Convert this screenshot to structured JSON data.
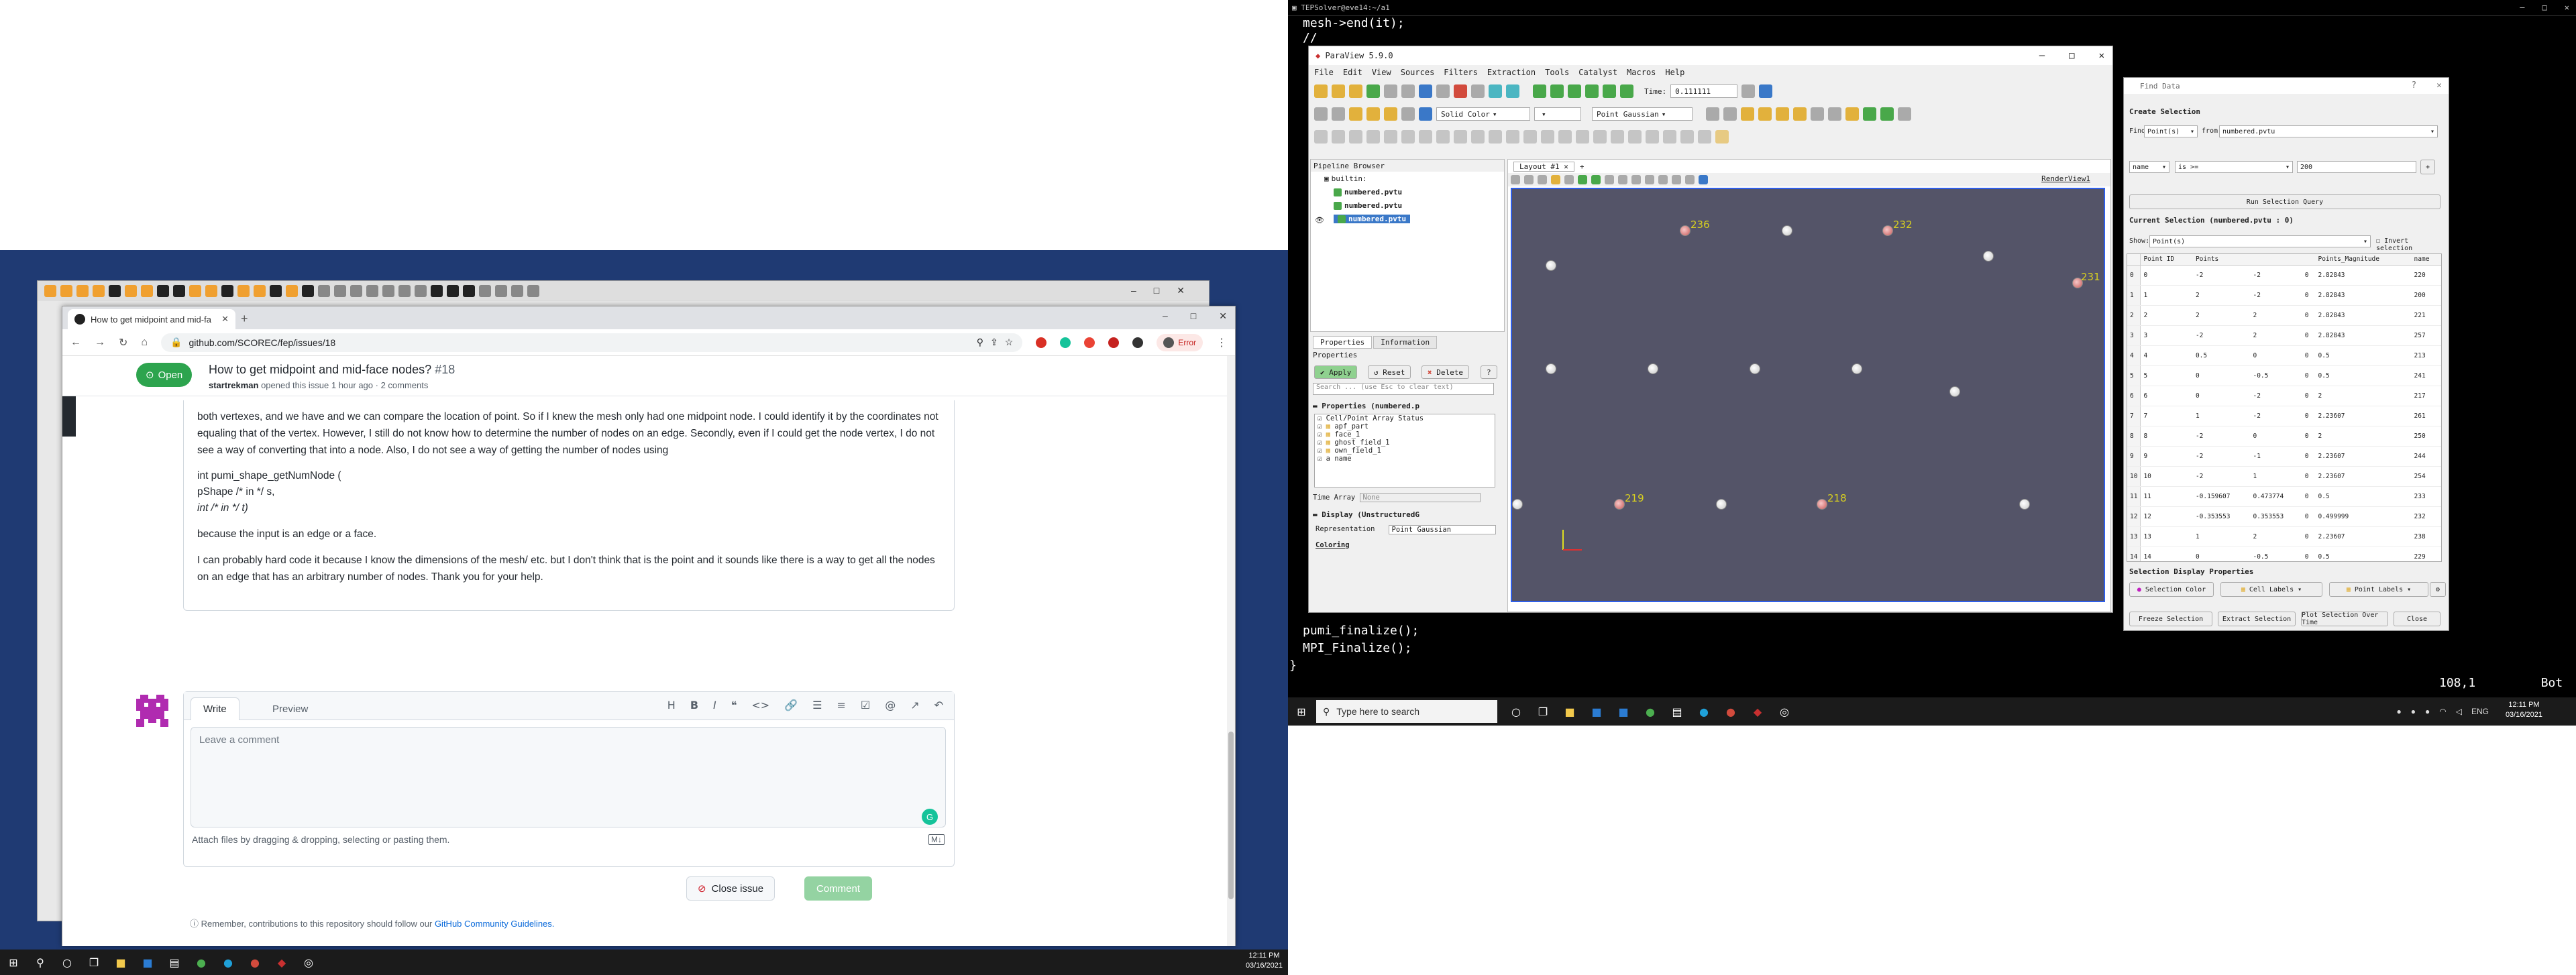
{
  "left_monitor": {
    "browser": {
      "tab_title": "How to get midpoint and mid-fa",
      "url": "github.com/SCOREC/fep/issues/18",
      "profile_label": "Error",
      "issue": {
        "state": "Open",
        "title": "How to get midpoint and mid-face nodes?",
        "number": "#18",
        "author": "startrekman",
        "opened_text": "opened this issue 1 hour ago · 2 comments",
        "body": [
          "both vertexes, and we have and we can compare the location of point. So if I knew the mesh only had one midpoint node. I could identify it by the coordinates not equaling that of the vertex. However, I still do not know how to determine the number of nodes on an edge. Secondly, even if I could get the node vertex, I do not see a way of converting that into a node. Also, I do not see a way of getting the number of nodes using",
          "because the input is an edge or a face.",
          "I can probably hard code it because I know the dimensions of the mesh/ etc. but I don't think that is the point and it sounds like there is a way to get all the nodes on an edge that has an arbitrary number of nodes. Thank you for your help."
        ],
        "code": [
          "int pumi_shape_getNumNode (",
          "pShape /* in */ s,",
          "int /* in */ t)"
        ]
      },
      "editor": {
        "tab_write": "Write",
        "tab_preview": "Preview",
        "placeholder": "Leave a comment",
        "attach_text": "Attach files by dragging & dropping, selecting or pasting them.",
        "close_issue": "Close issue",
        "comment": "Comment"
      },
      "note_prefix": "Remember, contributions to this repository should follow our",
      "note_link": "GitHub Community Guidelines."
    },
    "clock": {
      "time": "12:11 PM",
      "date": "03/16/2021"
    }
  },
  "right_monitor": {
    "terminal": {
      "title": "TEPSolver@eve14:~/a1",
      "lines_top": [
        "mesh->end(it);",
        "//"
      ],
      "lines_bottom": [
        "pumi_finalize();",
        "MPI_Finalize();",
        "}"
      ],
      "vim_status": "108,1         Bot"
    },
    "taskbar": {
      "search_placeholder": "Type here to search",
      "lang": "ENG",
      "time": "12:11 PM",
      "date": "03/16/2021"
    },
    "paraview": {
      "title": "ParaView 5.9.0",
      "menu": [
        "File",
        "Edit",
        "View",
        "Sources",
        "Filters",
        "Extraction",
        "Tools",
        "Catalyst",
        "Macros",
        "Help"
      ],
      "time_label": "Time:",
      "time_value": "0.111111",
      "color_mode": "Solid Color",
      "representation_select": "Point Gaussian",
      "pipeline_title": "Pipeline Browser",
      "pipeline_items": [
        "builtin:",
        "numbered.pvtu",
        "numbered.pvtu",
        "numbered.pvtu"
      ],
      "tab_properties": "Properties",
      "tab_information": "Information",
      "props_title": "Properties",
      "btn_apply": "Apply",
      "btn_reset": "Reset",
      "btn_delete": "Delete",
      "search_props": "Search ... (use Esc to clear text)",
      "props_section": "Properties (numbered.p",
      "array_status": "Cell/Point Array Status",
      "arrays": [
        "apf_part",
        "face_1",
        "ghost_field_1",
        "own_field_1",
        "name"
      ],
      "time_array_label": "Time Array",
      "time_array_value": "None",
      "display_section": "Display (UnstructuredG",
      "representation_label": "Representation",
      "representation_value": "Point Gaussian",
      "coloring_label": "Coloring",
      "layout_tab": "Layout #1",
      "renderview_label": "RenderView1",
      "node_labels": [
        "236",
        "232",
        "231",
        "219",
        "218"
      ]
    },
    "find_data": {
      "title": "Find Data",
      "create_selection": "Create Selection",
      "find_label": "Find",
      "find_value": "Point(s)",
      "from_label": "from",
      "from_value": "numbered.pvtu",
      "field_value": "name",
      "op_value": "is >=",
      "threshold_value": "200",
      "run_query": "Run Selection Query",
      "current_selection": "Current Selection (numbered.pvtu : 0)",
      "show_label": "Show:",
      "show_value": "Point(s)",
      "invert_label": "Invert selection",
      "columns": [
        "Point ID",
        "Points",
        "",
        "",
        "Points_Magnitude",
        "name"
      ],
      "rows": [
        [
          "0",
          "0",
          "-2",
          "-2",
          "0",
          "2.82843",
          "220"
        ],
        [
          "1",
          "1",
          "2",
          "-2",
          "0",
          "2.82843",
          "200"
        ],
        [
          "2",
          "2",
          "2",
          "2",
          "0",
          "2.82843",
          "221"
        ],
        [
          "3",
          "3",
          "-2",
          "2",
          "0",
          "2.82843",
          "257"
        ],
        [
          "4",
          "4",
          "0.5",
          "0",
          "0",
          "0.5",
          "213"
        ],
        [
          "5",
          "5",
          "0",
          "-0.5",
          "0",
          "0.5",
          "241"
        ],
        [
          "6",
          "6",
          "0",
          "-2",
          "0",
          "2",
          "217"
        ],
        [
          "7",
          "7",
          "1",
          "-2",
          "0",
          "2.23607",
          "261"
        ],
        [
          "8",
          "8",
          "-2",
          "0",
          "0",
          "2",
          "250"
        ],
        [
          "9",
          "9",
          "-2",
          "-1",
          "0",
          "2.23607",
          "244"
        ],
        [
          "10",
          "10",
          "-2",
          "1",
          "0",
          "2.23607",
          "254"
        ],
        [
          "11",
          "11",
          "-0.159607",
          "0.473774",
          "0",
          "0.5",
          "233"
        ],
        [
          "12",
          "12",
          "-0.353553",
          "0.353553",
          "0",
          "0.499999",
          "232"
        ],
        [
          "13",
          "13",
          "1",
          "2",
          "0",
          "2.23607",
          "238"
        ],
        [
          "14",
          "14",
          "0",
          "-0.5",
          "0",
          "0.5",
          "229"
        ]
      ],
      "display_props": "Selection Display Properties",
      "selection_color": "Selection Color",
      "cell_labels": "Cell Labels",
      "point_labels": "Point Labels",
      "freeze": "Freeze Selection",
      "extract": "Extract Selection",
      "plot_over_time": "Plot Selection Over Time",
      "close": "Close"
    }
  }
}
